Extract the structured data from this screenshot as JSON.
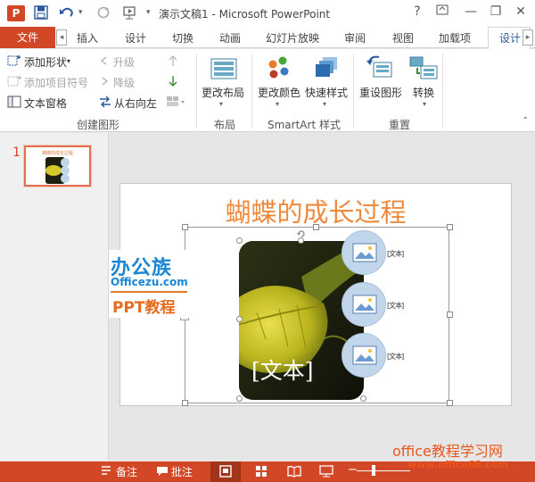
{
  "window": {
    "title": "演示文稿1 - Microsoft PowerPoint",
    "app_badge": "P",
    "help": "?",
    "minimize": "—",
    "restore": "❐",
    "close": "✕"
  },
  "qat": {
    "undo_caret": "▾",
    "more": "▾"
  },
  "tabs": {
    "file": "文件",
    "items": [
      "插入",
      "设计",
      "切换",
      "动画",
      "幻灯片放映",
      "审阅",
      "视图",
      "加载项"
    ],
    "active": "设计"
  },
  "ribbon": {
    "create_graphic": {
      "add_shape": "添加形状",
      "add_bullet": "添加项目符号",
      "text_pane": "文本窗格",
      "promote": "升级",
      "demote": "降级",
      "right_to_left": "从右向左",
      "group_label": "创建图形"
    },
    "layouts": {
      "change_layout": "更改布局",
      "group_label": "布局"
    },
    "styles": {
      "change_colors": "更改颜色",
      "quick_styles": "快速样式",
      "group_label": "SmartArt 样式"
    },
    "reset": {
      "reset_graphic": "重设图形",
      "convert": "转换",
      "group_label": "重置"
    }
  },
  "slides_pane": {
    "slide_number": "1",
    "thumb_title": "蝴蝶的成长过程"
  },
  "slide": {
    "title": "蝴蝶的成长过程",
    "placeholder_text": "[文本]",
    "bullet_labels": [
      "[文本]",
      "[文本]",
      "[文本]"
    ]
  },
  "watermark": {
    "brand_cn": "办公族",
    "brand_url": "Officezu.com",
    "tutorial": "PPT教程",
    "corner_title": "office教程学习网",
    "corner_url": "www.office68.com"
  },
  "statusbar": {
    "notes": "备注",
    "comments": "批注",
    "zoom_minus": "−"
  },
  "colors": {
    "accent": "#d24726",
    "title_orange": "#ee8a3e",
    "ribbon_blue": "#2b579a"
  }
}
